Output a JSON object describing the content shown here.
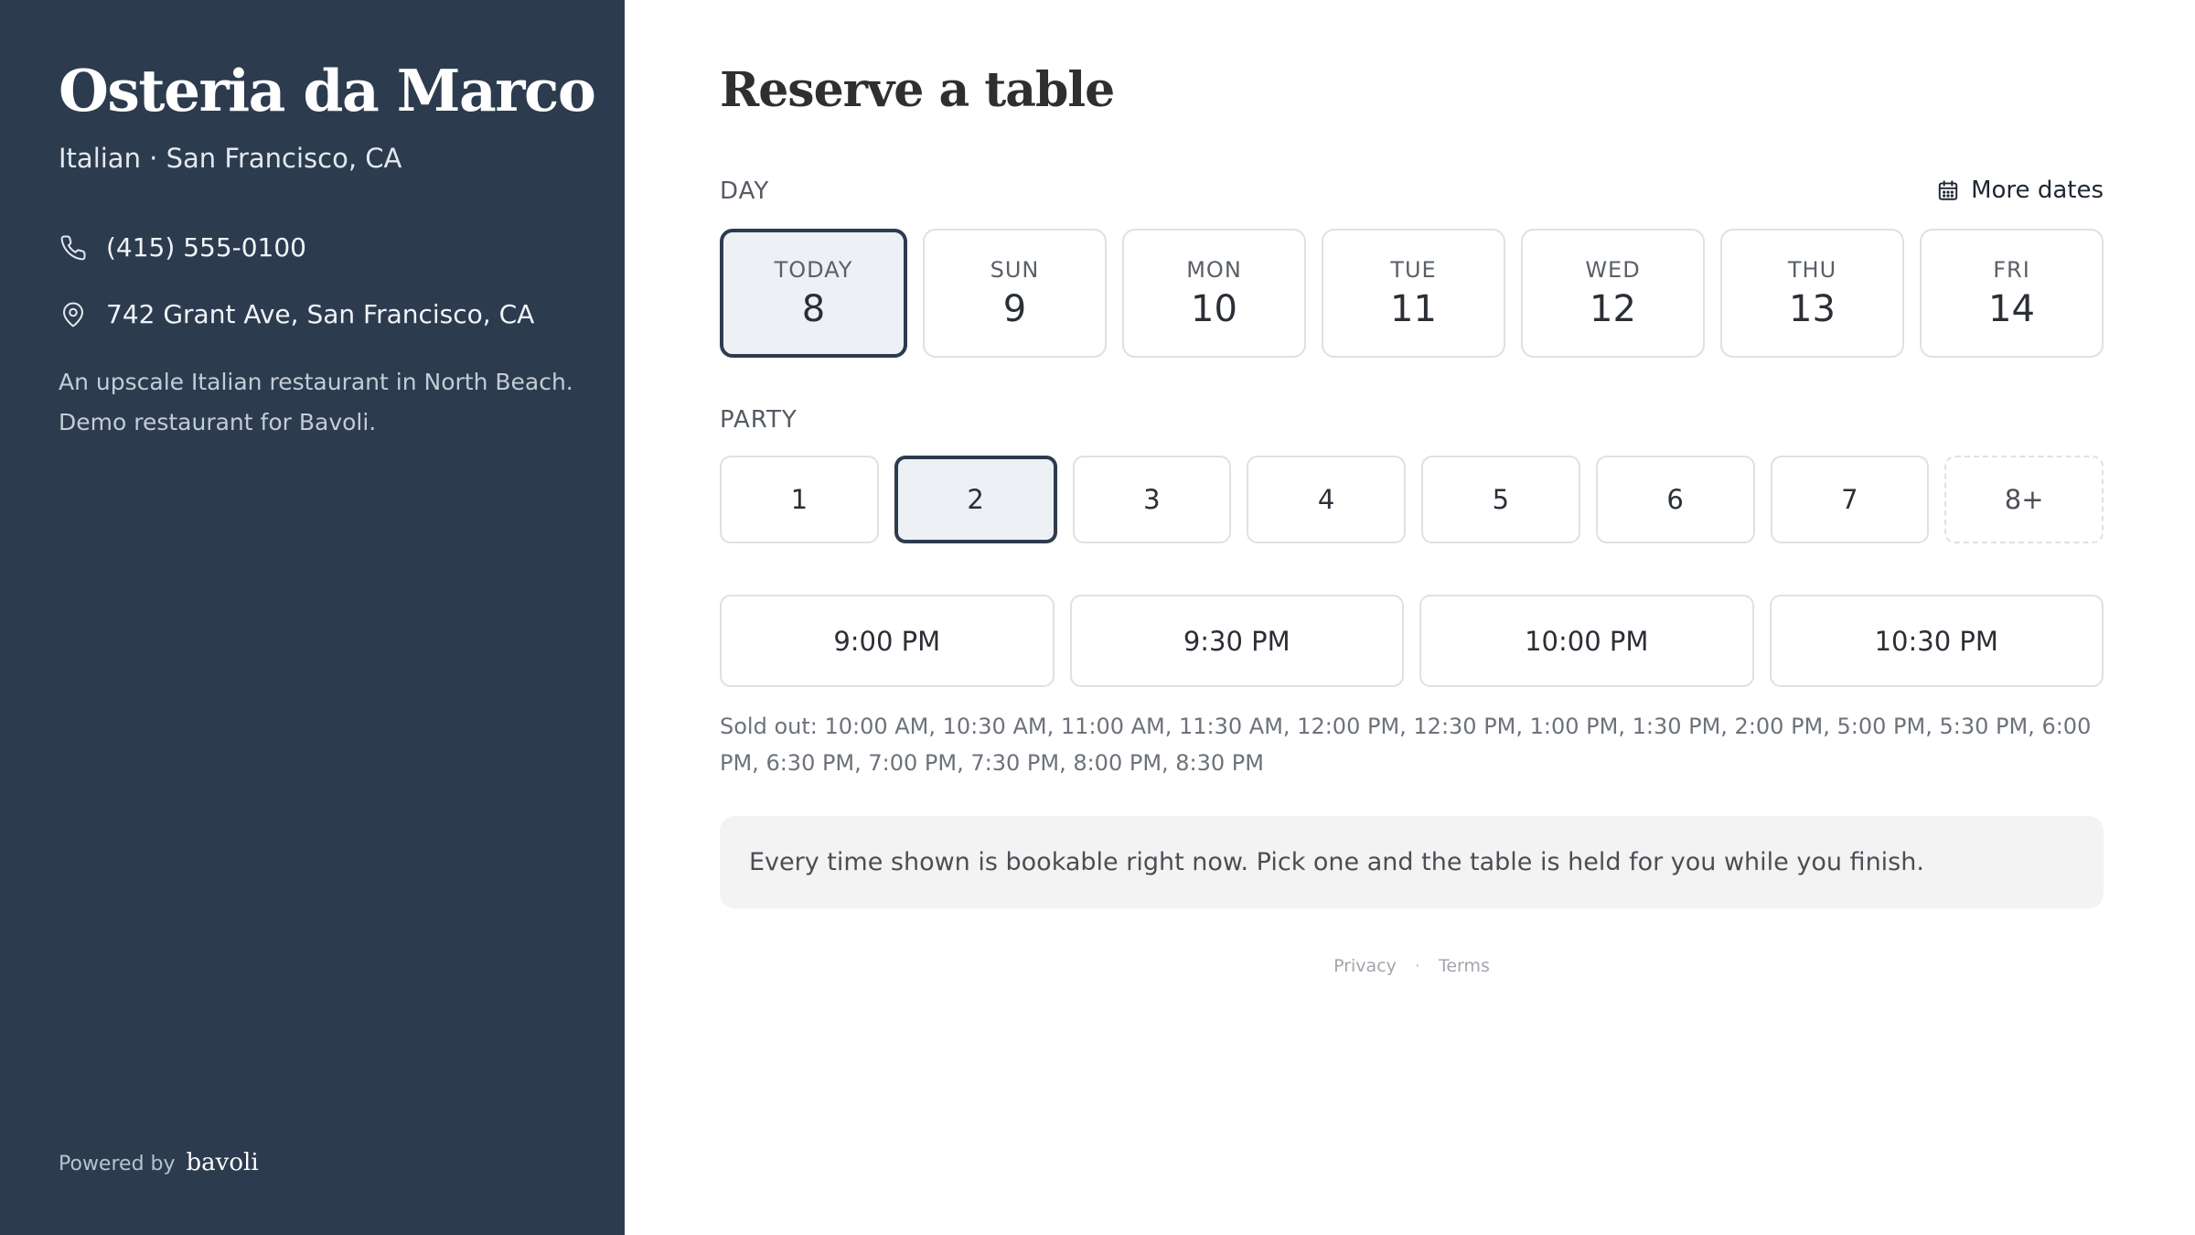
{
  "restaurant": {
    "name": "Osteria da Marco",
    "subtitle": "Italian · San Francisco, CA",
    "phone": "(415) 555-0100",
    "address": "742 Grant Ave, San Francisco, CA",
    "description": "An upscale Italian restaurant in North Beach. Demo restaurant for Bavoli."
  },
  "powered": {
    "label": "Powered by",
    "brand": "bavoli"
  },
  "main": {
    "title": "Reserve a table",
    "day_label": "DAY",
    "more_dates": "More dates",
    "days": [
      {
        "dow": "TODAY",
        "num": "8",
        "selected": true
      },
      {
        "dow": "SUN",
        "num": "9",
        "selected": false
      },
      {
        "dow": "MON",
        "num": "10",
        "selected": false
      },
      {
        "dow": "TUE",
        "num": "11",
        "selected": false
      },
      {
        "dow": "WED",
        "num": "12",
        "selected": false
      },
      {
        "dow": "THU",
        "num": "13",
        "selected": false
      },
      {
        "dow": "FRI",
        "num": "14",
        "selected": false
      }
    ],
    "party_label": "PARTY",
    "party": [
      "1",
      "2",
      "3",
      "4",
      "5",
      "6",
      "7",
      "8+"
    ],
    "party_selected": "2",
    "times": [
      "9:00 PM",
      "9:30 PM",
      "10:00 PM",
      "10:30 PM"
    ],
    "sold_out": "Sold out: 10:00 AM, 10:30 AM, 11:00 AM, 11:30 AM, 12:00 PM, 12:30 PM, 1:00 PM, 1:30 PM, 2:00 PM, 5:00 PM, 5:30 PM, 6:00 PM, 6:30 PM, 7:00 PM, 7:30 PM, 8:00 PM, 8:30 PM",
    "note": "Every time shown is bookable right now. Pick one and the table is held for you while you finish."
  },
  "footer": {
    "privacy": "Privacy",
    "separator": "·",
    "terms": "Terms"
  },
  "colors": {
    "sidebar_bg": "#2d3b4f",
    "selected_border": "#2d3b4f",
    "selected_bg": "#edf1f5"
  }
}
